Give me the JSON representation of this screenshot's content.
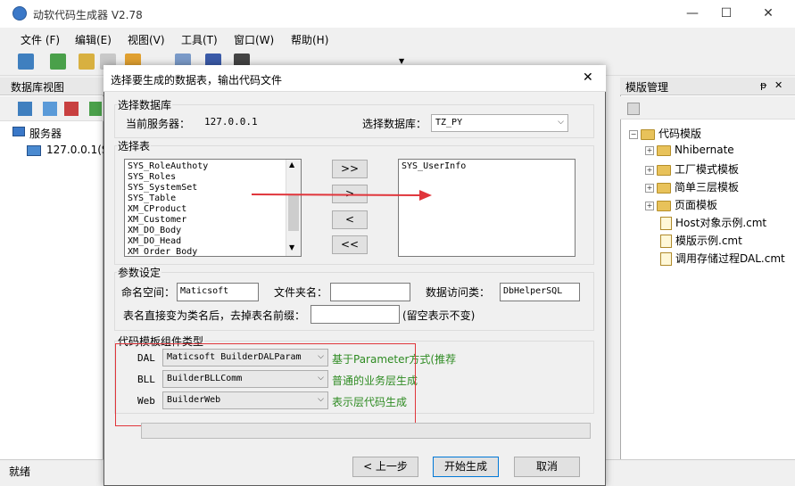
{
  "app": {
    "title": "动软代码生成器  V2.78",
    "minimize": "—",
    "maximize": "☐",
    "close": "✕"
  },
  "menu": [
    "文件 (F)",
    "编辑(E)",
    "视图(V)",
    "工具(T)",
    "窗口(W)",
    "帮助(H)"
  ],
  "left_panel": {
    "title": "数据库视图",
    "tree_root": "服务器",
    "tree_child": "127.0.0.1(S"
  },
  "right_panel": {
    "title": "模版管理",
    "pin": "ᵽ",
    "close": "✕",
    "root": "代码模版",
    "folders": [
      "Nhibernate",
      "工厂模式模板",
      "简单三层模板",
      "页面模板"
    ],
    "files": [
      "Host对象示例.cmt",
      "模版示例.cmt",
      "调用存储过程DAL.cmt"
    ]
  },
  "status": "就绪",
  "dialog": {
    "title": "选择要生成的数据表，输出代码文件",
    "close": "✕",
    "db_group": "选择数据库",
    "server_label": "当前服务器：",
    "server_value": "127.0.0.1",
    "db_label": "选择数据库：",
    "db_value": "TZ_PY",
    "table_group": "选择表",
    "tables": [
      "SYS_RoleAuthoty",
      "SYS_Roles",
      "SYS_SystemSet",
      "SYS_Table",
      "XM_CProduct",
      "XM_Customer",
      "XM_DO_Body",
      "XM_DO_Head",
      "XM_Order_Body"
    ],
    "selected_tables": [
      "SYS_UserInfo"
    ],
    "move_all_right": ">>",
    "move_right": ">",
    "move_left": "<",
    "move_all_left": "<<",
    "param_group": "参数设定",
    "namespace_label": "命名空间：",
    "namespace_value": "Maticsoft",
    "folder_label": "文件夹名：",
    "folder_value": "",
    "dac_label": "数据访问类：",
    "dac_value": "DbHelperSQL",
    "prefix_label": "表名直接变为类名后，去掉表名前缀：",
    "prefix_value": "",
    "prefix_hint": "(留空表示不变)",
    "template_group": "代码模板组件类型",
    "layers": [
      {
        "label": "DAL",
        "value": "Maticsoft BuilderDALParam",
        "desc": "基于Parameter方式(推荐"
      },
      {
        "label": "BLL",
        "value": "BuilderBLLComm",
        "desc": "普通的业务层生成"
      },
      {
        "label": "Web",
        "value": "BuilderWeb",
        "desc": "表示层代码生成"
      }
    ],
    "progress": 0,
    "back_button": "< 上一步",
    "start_button": "开始生成",
    "cancel_button": "取消"
  },
  "colors": {
    "annotation": "#e0353b",
    "accent": "#0078d7",
    "desc_green": "#2e8b22"
  }
}
